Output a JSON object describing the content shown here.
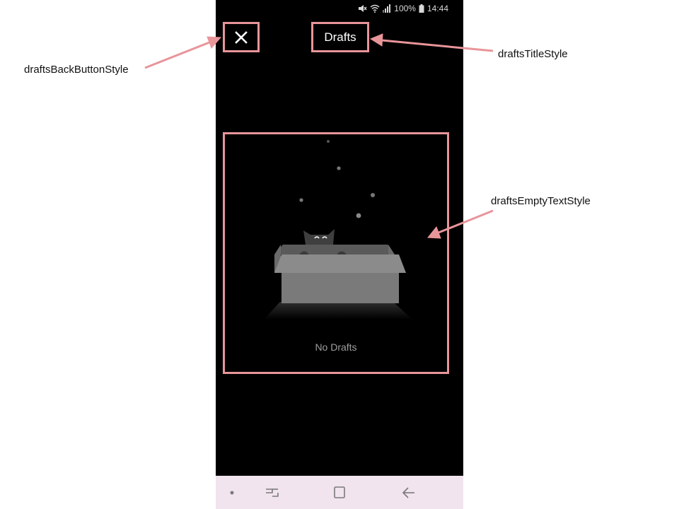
{
  "status_bar": {
    "battery_text": "100%",
    "time": "14:44"
  },
  "header": {
    "close_icon": "close-icon",
    "title": "Drafts"
  },
  "empty_state": {
    "illustration": "cat-in-box-illustration",
    "text": "No Drafts"
  },
  "nav_bar": {
    "icons": [
      "dot-icon",
      "recent-apps-icon",
      "home-icon",
      "back-arrow-icon"
    ]
  },
  "annotations": {
    "back_button_label": "draftsBackButtonStyle",
    "title_label": "draftsTitleStyle",
    "empty_text_label": "draftsEmptyTextStyle",
    "highlight_color": "#e8959a"
  }
}
